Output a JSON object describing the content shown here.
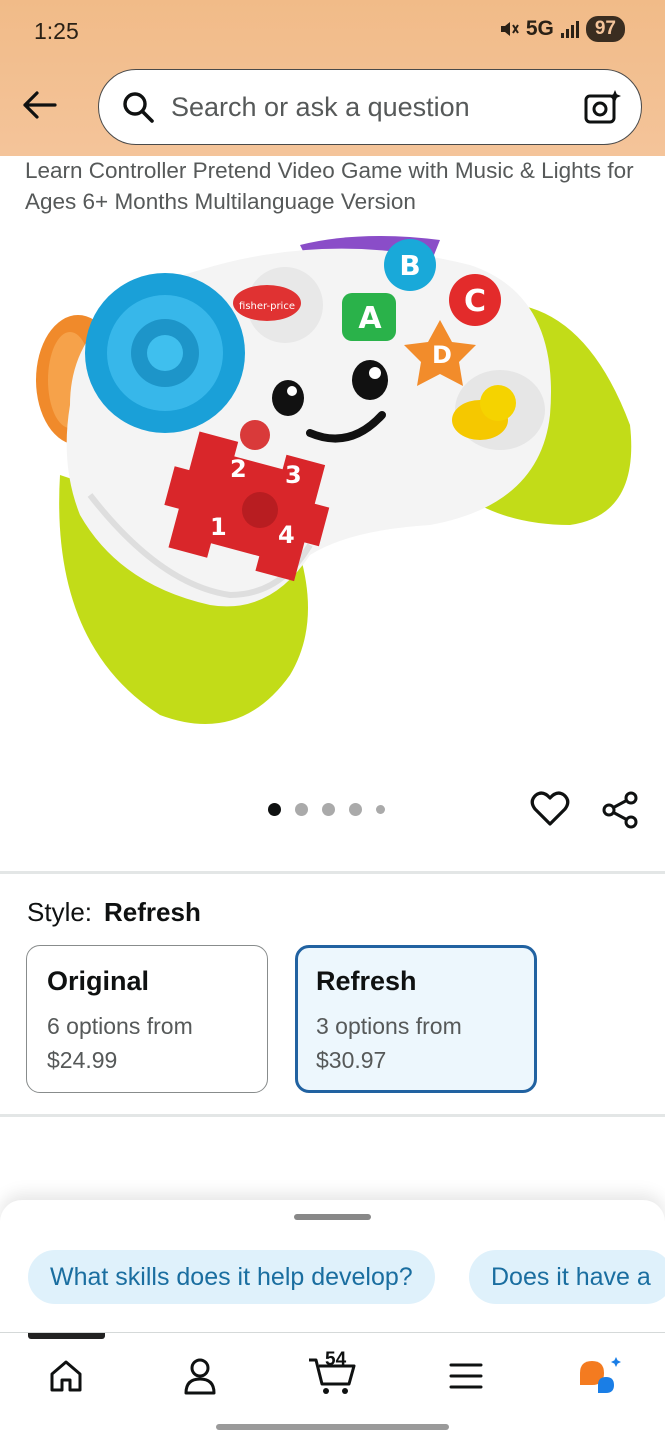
{
  "status_bar": {
    "time": "1:25",
    "network": "5G",
    "battery": "97"
  },
  "header": {
    "search_placeholder": "Search or ask a question",
    "back_icon": "arrow-left-icon",
    "search_icon": "search-icon",
    "camera_icon": "camera-sparkle-icon"
  },
  "product": {
    "title": "Learn Controller Pretend Video Game with Music & Lights for Ages 6+ Months Multilanguage Version",
    "image_alt": "Fisher-Price toy game controller",
    "carousel": {
      "count": 5,
      "active_index": 0
    },
    "toy_labels": {
      "brand": "fisher-price",
      "b": "B",
      "c": "C",
      "a": "A",
      "d": "D",
      "n1": "1",
      "n2": "2",
      "n3": "3",
      "n4": "4"
    }
  },
  "style_selector": {
    "label": "Style:",
    "selected": "Refresh",
    "options": [
      {
        "name": "Original",
        "line1": "6 options from",
        "line2": "$24.99"
      },
      {
        "name": "Refresh",
        "line1": "3 options from",
        "line2": "$30.97"
      }
    ]
  },
  "suggestions": [
    "What skills does it help develop?",
    "Does it have a"
  ],
  "bottom_nav": {
    "cart_count": "54",
    "items": [
      "home-icon",
      "account-icon",
      "cart-icon",
      "menu-icon",
      "rufus-icon"
    ]
  },
  "colors": {
    "header_bg": "#f3c196",
    "selected_border": "#2162a1",
    "chip_bg": "#dff1fb",
    "chip_text": "#1a6ea0"
  }
}
